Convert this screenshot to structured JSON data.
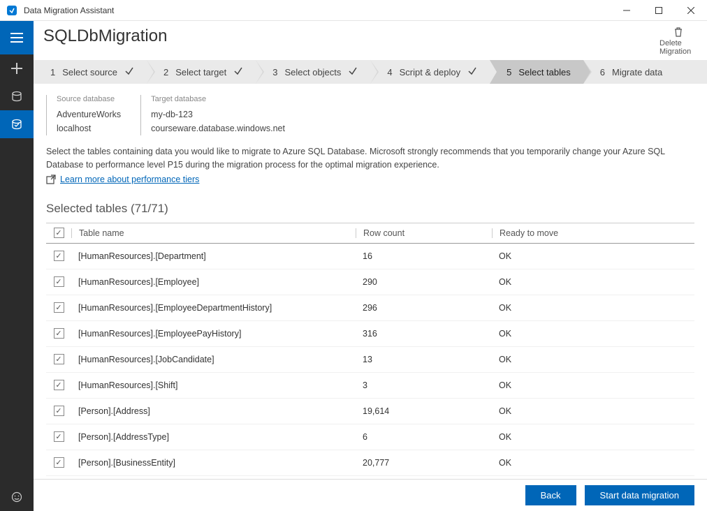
{
  "app": {
    "title": "Data Migration Assistant"
  },
  "header": {
    "project_name": "SQLDbMigration",
    "delete_label": "Delete Migration"
  },
  "steps": [
    {
      "num": "1",
      "label": "Select source",
      "done": true,
      "current": false
    },
    {
      "num": "2",
      "label": "Select target",
      "done": true,
      "current": false
    },
    {
      "num": "3",
      "label": "Select objects",
      "done": true,
      "current": false
    },
    {
      "num": "4",
      "label": "Script & deploy",
      "done": true,
      "current": false
    },
    {
      "num": "5",
      "label": "Select tables",
      "done": false,
      "current": true
    },
    {
      "num": "6",
      "label": "Migrate data",
      "done": false,
      "current": false
    }
  ],
  "dbinfo": {
    "source_label": "Source database",
    "source_db": "AdventureWorks",
    "source_host": "localhost",
    "target_label": "Target database",
    "target_db": "my-db-123",
    "target_host": "courseware.database.windows.net"
  },
  "instruction": "Select the tables containing data you would like to migrate to Azure SQL Database. Microsoft strongly recommends that you temporarily change your Azure SQL Database to performance level P15 during the migration process for the optimal migration experience.",
  "learn_more": "Learn more about performance tiers",
  "selected_heading": "Selected tables (71/71)",
  "columns": {
    "name": "Table name",
    "rowcount": "Row count",
    "ready": "Ready to move"
  },
  "tables": [
    {
      "name": "[HumanResources].[Department]",
      "rows": "16",
      "ready": "OK",
      "checked": true
    },
    {
      "name": "[HumanResources].[Employee]",
      "rows": "290",
      "ready": "OK",
      "checked": true
    },
    {
      "name": "[HumanResources].[EmployeeDepartmentHistory]",
      "rows": "296",
      "ready": "OK",
      "checked": true
    },
    {
      "name": "[HumanResources].[EmployeePayHistory]",
      "rows": "316",
      "ready": "OK",
      "checked": true
    },
    {
      "name": "[HumanResources].[JobCandidate]",
      "rows": "13",
      "ready": "OK",
      "checked": true
    },
    {
      "name": "[HumanResources].[Shift]",
      "rows": "3",
      "ready": "OK",
      "checked": true
    },
    {
      "name": "[Person].[Address]",
      "rows": "19,614",
      "ready": "OK",
      "checked": true
    },
    {
      "name": "[Person].[AddressType]",
      "rows": "6",
      "ready": "OK",
      "checked": true
    },
    {
      "name": "[Person].[BusinessEntity]",
      "rows": "20,777",
      "ready": "OK",
      "checked": true
    }
  ],
  "footer": {
    "back": "Back",
    "start": "Start data migration"
  }
}
